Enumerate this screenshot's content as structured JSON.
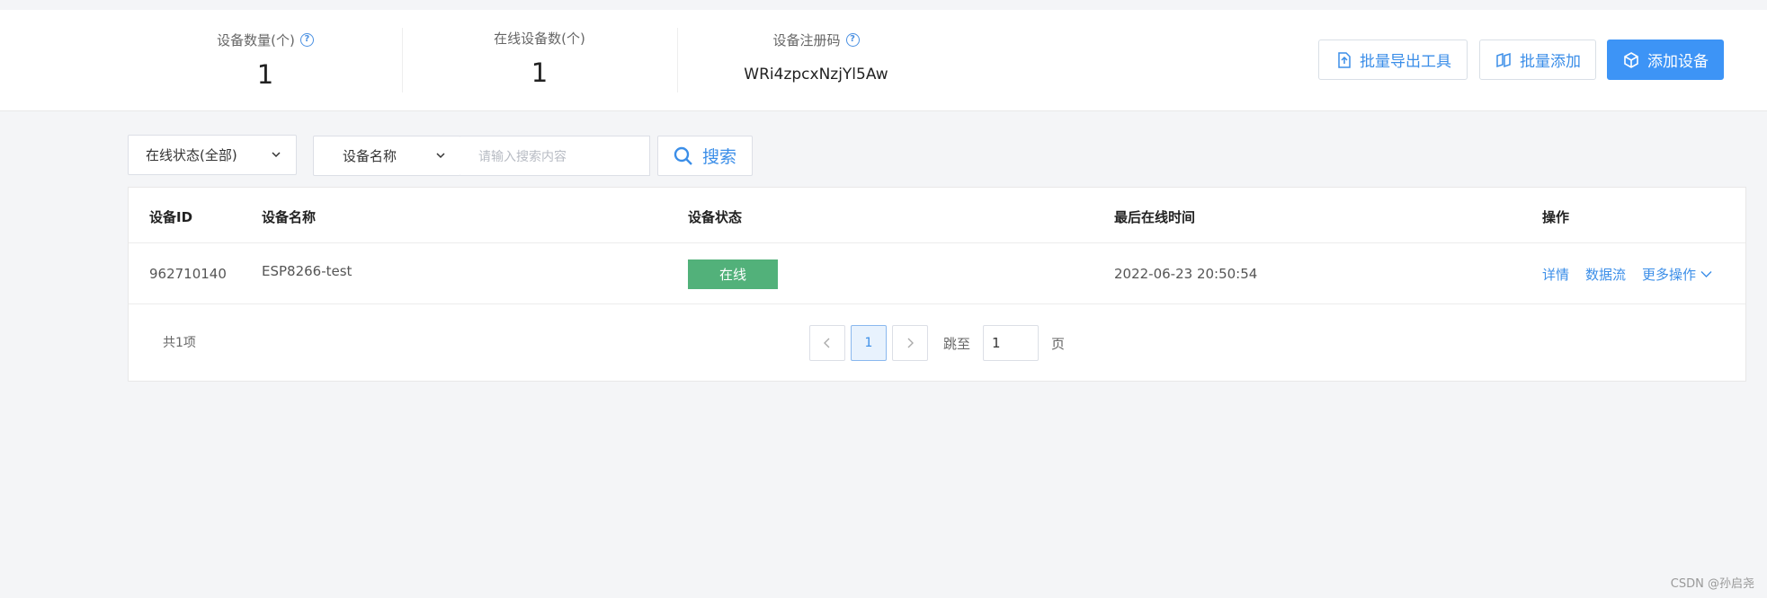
{
  "stats": {
    "device_count_label": "设备数量(个)",
    "device_count_value": "1",
    "online_count_label": "在线设备数(个)",
    "online_count_value": "1",
    "register_code_label": "设备注册码",
    "register_code_value": "WRi4zpcxNzjYl5Aw"
  },
  "actions": {
    "export_tool": "批量导出工具",
    "batch_add": "批量添加",
    "add_device": "添加设备"
  },
  "filters": {
    "status_select": "在线状态(全部)",
    "field_select": "设备名称",
    "search_placeholder": "请输入搜索内容",
    "search_button": "搜索"
  },
  "table": {
    "headers": [
      "设备ID",
      "设备名称",
      "设备状态",
      "最后在线时间",
      "操作"
    ],
    "rows": [
      {
        "device_id": "962710140",
        "device_name": "ESP8266-test",
        "status": "在线",
        "last_online": "2022-06-23 20:50:54",
        "ops": [
          "详情",
          "数据流",
          "更多操作"
        ]
      }
    ]
  },
  "pagination": {
    "total": "共1项",
    "current_page": "1",
    "jump_label": "跳至",
    "jump_value": "1",
    "page_suffix": "页"
  },
  "watermark": "CSDN @孙启尧",
  "colors": {
    "accent": "#3d94f6",
    "link": "#3b8ee8",
    "online_badge": "#52b17a",
    "background": "#f4f5f7"
  },
  "icons": {
    "help": "help-circle-icon",
    "export": "export-icon",
    "batch_add": "copy-icon",
    "add_device": "box-icon",
    "search": "search-icon",
    "dropdown": "chevron-down-icon",
    "prev": "chevron-left-icon",
    "next": "chevron-right-icon"
  }
}
